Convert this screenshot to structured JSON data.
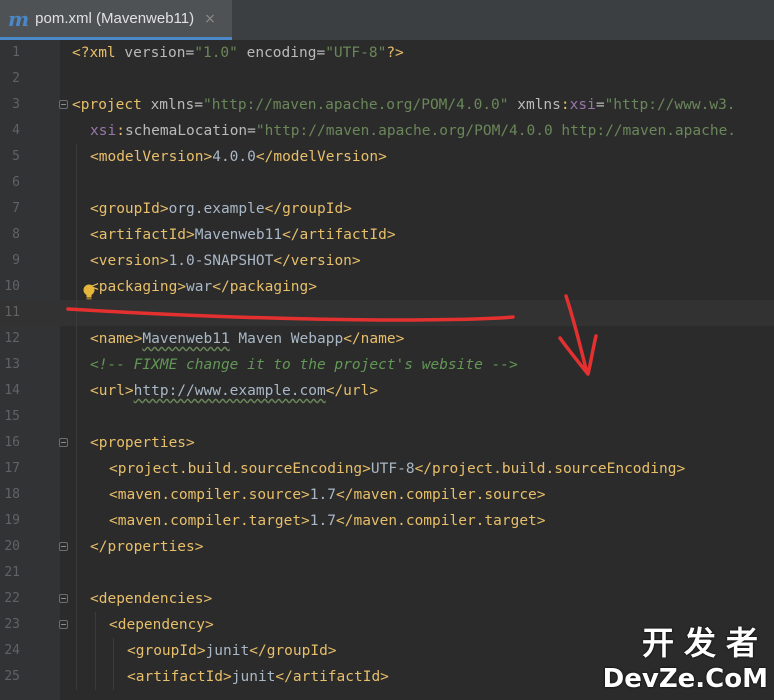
{
  "tab": {
    "icon_letter": "m",
    "title": "pom.xml (Mavenweb11)",
    "close": "×"
  },
  "lines": [
    {
      "n": "1",
      "parts": [
        [
          "tag",
          "<?xml "
        ],
        [
          "attr",
          "version="
        ],
        [
          "str",
          "\"1.0\""
        ],
        [
          "attr",
          " encoding="
        ],
        [
          "str",
          "\"UTF-8\""
        ],
        [
          "tag",
          "?>"
        ]
      ]
    },
    {
      "n": "2",
      "parts": []
    },
    {
      "n": "3",
      "parts": [
        [
          "tag",
          "<project "
        ],
        [
          "attr",
          "xmlns="
        ],
        [
          "str",
          "\"http://maven.apache.org/POM/4.0.0\""
        ],
        [
          "attr",
          " xmlns"
        ],
        [
          "tag",
          ":"
        ],
        [
          "ns",
          "xsi"
        ],
        [
          "attr",
          "="
        ],
        [
          "str",
          "\"http://www.w3."
        ]
      ]
    },
    {
      "n": "4",
      "parts": [
        [
          "ns",
          "xsi"
        ],
        [
          "tag",
          ":"
        ],
        [
          "attr",
          "schemaLocation="
        ],
        [
          "str",
          "\"http://maven.apache.org/POM/4.0.0 http://maven.apache."
        ]
      ]
    },
    {
      "n": "5",
      "parts": [
        [
          "tag",
          "<modelVersion>"
        ],
        [
          "text",
          "4.0.0"
        ],
        [
          "tag",
          "</modelVersion>"
        ]
      ]
    },
    {
      "n": "6",
      "parts": []
    },
    {
      "n": "7",
      "parts": [
        [
          "tag",
          "<groupId>"
        ],
        [
          "text",
          "org.example"
        ],
        [
          "tag",
          "</groupId>"
        ]
      ]
    },
    {
      "n": "8",
      "parts": [
        [
          "tag",
          "<artifactId>"
        ],
        [
          "text",
          "Mavenweb11"
        ],
        [
          "tag",
          "</artifactId>"
        ]
      ]
    },
    {
      "n": "9",
      "parts": [
        [
          "tag",
          "<version>"
        ],
        [
          "text",
          "1.0-SNAPSHOT"
        ],
        [
          "tag",
          "</version>"
        ]
      ]
    },
    {
      "n": "10",
      "parts": [
        [
          "tag",
          "<packaging>"
        ],
        [
          "text",
          "war"
        ],
        [
          "tag",
          "</packaging>"
        ]
      ]
    },
    {
      "n": "11",
      "parts": []
    },
    {
      "n": "12",
      "parts": [
        [
          "tag",
          "<name>"
        ],
        [
          "wavy",
          "Mavenweb11"
        ],
        [
          "text",
          " Maven Webapp"
        ],
        [
          "tag",
          "</name>"
        ]
      ]
    },
    {
      "n": "13",
      "parts": [
        [
          "cmt",
          "<!-- FIXME change it to the project's website -->"
        ]
      ]
    },
    {
      "n": "14",
      "parts": [
        [
          "tag",
          "<url>"
        ],
        [
          "wavy",
          "http://www.example.com"
        ],
        [
          "tag",
          "</url>"
        ]
      ]
    },
    {
      "n": "15",
      "parts": []
    },
    {
      "n": "16",
      "parts": [
        [
          "tag",
          "<properties>"
        ]
      ]
    },
    {
      "n": "17",
      "parts": [
        [
          "tag",
          "<project.build.sourceEncoding>"
        ],
        [
          "text",
          "UTF-8"
        ],
        [
          "tag",
          "</project.build.sourceEncoding>"
        ]
      ]
    },
    {
      "n": "18",
      "parts": [
        [
          "tag",
          "<maven.compiler.source>"
        ],
        [
          "text",
          "1.7"
        ],
        [
          "tag",
          "</maven.compiler.source>"
        ]
      ]
    },
    {
      "n": "19",
      "parts": [
        [
          "tag",
          "<maven.compiler.target>"
        ],
        [
          "text",
          "1.7"
        ],
        [
          "tag",
          "</maven.compiler.target>"
        ]
      ]
    },
    {
      "n": "20",
      "parts": [
        [
          "tag",
          "</properties>"
        ]
      ]
    },
    {
      "n": "21",
      "parts": []
    },
    {
      "n": "22",
      "parts": [
        [
          "tag",
          "<dependencies>"
        ]
      ]
    },
    {
      "n": "23",
      "parts": [
        [
          "tag",
          "<dependency>"
        ]
      ]
    },
    {
      "n": "24",
      "parts": [
        [
          "tag",
          "<groupId>"
        ],
        [
          "text",
          "junit"
        ],
        [
          "tag",
          "</groupId>"
        ]
      ]
    },
    {
      "n": "25",
      "parts": [
        [
          "tag",
          "<artifactId>"
        ],
        [
          "text",
          "junit"
        ],
        [
          "tag",
          "</artifactId>"
        ]
      ]
    }
  ],
  "watermark": {
    "cn": "开发者",
    "en": "DevZe.CoM"
  },
  "colors": {
    "tag": "#e8bf6a",
    "string": "#6a8759",
    "comment": "#629755",
    "annotation": "#e53030"
  }
}
